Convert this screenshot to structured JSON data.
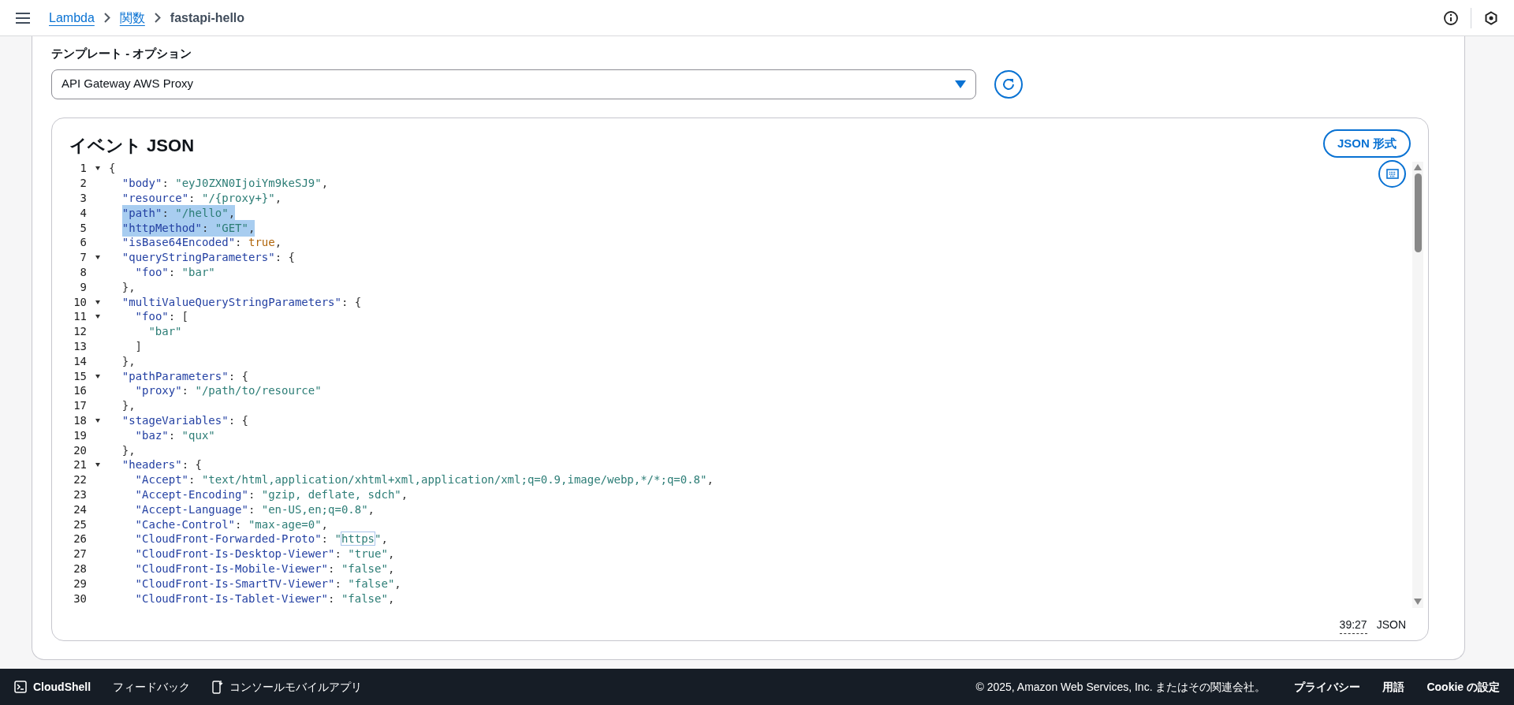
{
  "top_bar": {
    "breadcrumbs": [
      {
        "label": "Lambda",
        "kind": "link"
      },
      {
        "label": "関数",
        "kind": "link"
      },
      {
        "label": "fastapi-hello",
        "kind": "current"
      }
    ]
  },
  "template": {
    "label": "テンプレート - オプション",
    "value": "API Gateway AWS Proxy"
  },
  "editor": {
    "title": "イベント JSON",
    "format_button": "JSON 形式",
    "lines": [
      {
        "number": "1",
        "foldable": true,
        "selected": false,
        "tokens": [
          {
            "kind": "punct",
            "text": "{"
          }
        ],
        "children": [
          {
            "number": "2",
            "foldable": false,
            "selected": false,
            "tokens": [
              {
                "kind": "key",
                "text": "\"body\""
              },
              {
                "kind": "punct",
                "text": ": "
              },
              {
                "kind": "string",
                "text": "\"eyJ0ZXN0IjoiYm9keSJ9\""
              },
              {
                "kind": "punct",
                "text": ","
              }
            ]
          },
          {
            "number": "3",
            "foldable": false,
            "selected": false,
            "tokens": [
              {
                "kind": "key",
                "text": "\"resource\""
              },
              {
                "kind": "punct",
                "text": ": "
              },
              {
                "kind": "string",
                "text": "\"/{proxy+}\""
              },
              {
                "kind": "punct",
                "text": ","
              }
            ]
          },
          {
            "number": "4",
            "foldable": false,
            "selected": true,
            "tokens": [
              {
                "kind": "key",
                "text": "\"path\""
              },
              {
                "kind": "punct",
                "text": ": "
              },
              {
                "kind": "string",
                "text": "\"/hello\""
              },
              {
                "kind": "punct",
                "text": ","
              }
            ]
          },
          {
            "number": "5",
            "foldable": false,
            "selected": true,
            "tokens": [
              {
                "kind": "key",
                "text": "\"httpMethod\""
              },
              {
                "kind": "punct",
                "text": ": "
              },
              {
                "kind": "string",
                "text": "\"GET\""
              },
              {
                "kind": "punct",
                "text": ","
              }
            ]
          },
          {
            "number": "6",
            "foldable": false,
            "selected": false,
            "tokens": [
              {
                "kind": "key",
                "text": "\"isBase64Encoded\""
              },
              {
                "kind": "punct",
                "text": ": "
              },
              {
                "kind": "bool",
                "text": "true"
              },
              {
                "kind": "punct",
                "text": ","
              }
            ]
          },
          {
            "number": "7",
            "foldable": true,
            "selected": false,
            "tokens": [
              {
                "kind": "key",
                "text": "\"queryStringParameters\""
              },
              {
                "kind": "punct",
                "text": ": {"
              }
            ],
            "children": [
              {
                "number": "8",
                "foldable": false,
                "selected": false,
                "tokens": [
                  {
                    "kind": "key",
                    "text": "\"foo\""
                  },
                  {
                    "kind": "punct",
                    "text": ": "
                  },
                  {
                    "kind": "string",
                    "text": "\"bar\""
                  }
                ]
              }
            ]
          },
          {
            "number": "9",
            "foldable": false,
            "selected": false,
            "tokens": [
              {
                "kind": "punct",
                "text": "},"
              }
            ]
          },
          {
            "number": "10",
            "foldable": true,
            "selected": false,
            "tokens": [
              {
                "kind": "key",
                "text": "\"multiValueQueryStringParameters\""
              },
              {
                "kind": "punct",
                "text": ": {"
              }
            ],
            "children": [
              {
                "number": "11",
                "foldable": true,
                "selected": false,
                "tokens": [
                  {
                    "kind": "key",
                    "text": "\"foo\""
                  },
                  {
                    "kind": "punct",
                    "text": ": ["
                  }
                ],
                "children": [
                  {
                    "number": "12",
                    "foldable": false,
                    "selected": false,
                    "tokens": [
                      {
                        "kind": "string",
                        "text": "\"bar\""
                      }
                    ]
                  }
                ]
              },
              {
                "number": "13",
                "foldable": false,
                "selected": false,
                "tokens": [
                  {
                    "kind": "punct",
                    "text": "]"
                  }
                ]
              }
            ]
          },
          {
            "number": "14",
            "foldable": false,
            "selected": false,
            "tokens": [
              {
                "kind": "punct",
                "text": "},"
              }
            ]
          },
          {
            "number": "15",
            "foldable": true,
            "selected": false,
            "tokens": [
              {
                "kind": "key",
                "text": "\"pathParameters\""
              },
              {
                "kind": "punct",
                "text": ": {"
              }
            ],
            "children": [
              {
                "number": "16",
                "foldable": false,
                "selected": false,
                "tokens": [
                  {
                    "kind": "key",
                    "text": "\"proxy\""
                  },
                  {
                    "kind": "punct",
                    "text": ": "
                  },
                  {
                    "kind": "string",
                    "text": "\"/path/to/resource\""
                  }
                ]
              }
            ]
          },
          {
            "number": "17",
            "foldable": false,
            "selected": false,
            "tokens": [
              {
                "kind": "punct",
                "text": "},"
              }
            ]
          },
          {
            "number": "18",
            "foldable": true,
            "selected": false,
            "tokens": [
              {
                "kind": "key",
                "text": "\"stageVariables\""
              },
              {
                "kind": "punct",
                "text": ": {"
              }
            ],
            "children": [
              {
                "number": "19",
                "foldable": false,
                "selected": false,
                "tokens": [
                  {
                    "kind": "key",
                    "text": "\"baz\""
                  },
                  {
                    "kind": "punct",
                    "text": ": "
                  },
                  {
                    "kind": "string",
                    "text": "\"qux\""
                  }
                ]
              }
            ]
          },
          {
            "number": "20",
            "foldable": false,
            "selected": false,
            "tokens": [
              {
                "kind": "punct",
                "text": "},"
              }
            ]
          },
          {
            "number": "21",
            "foldable": true,
            "selected": false,
            "tokens": [
              {
                "kind": "key",
                "text": "\"headers\""
              },
              {
                "kind": "punct",
                "text": ": {"
              }
            ],
            "children": [
              {
                "number": "22",
                "foldable": false,
                "selected": false,
                "tokens": [
                  {
                    "kind": "key",
                    "text": "\"Accept\""
                  },
                  {
                    "kind": "punct",
                    "text": ": "
                  },
                  {
                    "kind": "string",
                    "text": "\"text/html,application/xhtml+xml,application/xml;q=0.9,image/webp,*/*;q=0.8\""
                  },
                  {
                    "kind": "punct",
                    "text": ","
                  }
                ]
              },
              {
                "number": "23",
                "foldable": false,
                "selected": false,
                "tokens": [
                  {
                    "kind": "key",
                    "text": "\"Accept-Encoding\""
                  },
                  {
                    "kind": "punct",
                    "text": ": "
                  },
                  {
                    "kind": "string",
                    "text": "\"gzip, deflate, sdch\""
                  },
                  {
                    "kind": "punct",
                    "text": ","
                  }
                ]
              },
              {
                "number": "24",
                "foldable": false,
                "selected": false,
                "tokens": [
                  {
                    "kind": "key",
                    "text": "\"Accept-Language\""
                  },
                  {
                    "kind": "punct",
                    "text": ": "
                  },
                  {
                    "kind": "string",
                    "text": "\"en-US,en;q=0.8\""
                  },
                  {
                    "kind": "punct",
                    "text": ","
                  }
                ]
              },
              {
                "number": "25",
                "foldable": false,
                "selected": false,
                "tokens": [
                  {
                    "kind": "key",
                    "text": "\"Cache-Control\""
                  },
                  {
                    "kind": "punct",
                    "text": ": "
                  },
                  {
                    "kind": "string",
                    "text": "\"max-age=0\""
                  },
                  {
                    "kind": "punct",
                    "text": ","
                  }
                ]
              },
              {
                "number": "26",
                "foldable": false,
                "selected": false,
                "tokens": [
                  {
                    "kind": "key",
                    "text": "\"CloudFront-Forwarded-Proto\""
                  },
                  {
                    "kind": "punct",
                    "text": ": "
                  },
                  {
                    "kind": "string",
                    "text": "\""
                  },
                  {
                    "kind": "match",
                    "text": "https"
                  },
                  {
                    "kind": "string",
                    "text": "\""
                  },
                  {
                    "kind": "punct",
                    "text": ","
                  }
                ]
              },
              {
                "number": "27",
                "foldable": false,
                "selected": false,
                "tokens": [
                  {
                    "kind": "key",
                    "text": "\"CloudFront-Is-Desktop-Viewer\""
                  },
                  {
                    "kind": "punct",
                    "text": ": "
                  },
                  {
                    "kind": "string",
                    "text": "\"true\""
                  },
                  {
                    "kind": "punct",
                    "text": ","
                  }
                ]
              },
              {
                "number": "28",
                "foldable": false,
                "selected": false,
                "tokens": [
                  {
                    "kind": "key",
                    "text": "\"CloudFront-Is-Mobile-Viewer\""
                  },
                  {
                    "kind": "punct",
                    "text": ": "
                  },
                  {
                    "kind": "string",
                    "text": "\"false\""
                  },
                  {
                    "kind": "punct",
                    "text": ","
                  }
                ]
              },
              {
                "number": "29",
                "foldable": false,
                "selected": false,
                "tokens": [
                  {
                    "kind": "key",
                    "text": "\"CloudFront-Is-SmartTV-Viewer\""
                  },
                  {
                    "kind": "punct",
                    "text": ": "
                  },
                  {
                    "kind": "string",
                    "text": "\"false\""
                  },
                  {
                    "kind": "punct",
                    "text": ","
                  }
                ]
              },
              {
                "number": "30",
                "foldable": false,
                "selected": false,
                "tokens": [
                  {
                    "kind": "key",
                    "text": "\"CloudFront-Is-Tablet-Viewer\""
                  },
                  {
                    "kind": "punct",
                    "text": ": "
                  },
                  {
                    "kind": "string",
                    "text": "\"false\""
                  },
                  {
                    "kind": "punct",
                    "text": ","
                  }
                ]
              }
            ]
          }
        ]
      }
    ],
    "status": {
      "cursor": "39:27",
      "mode": "JSON"
    }
  },
  "footer": {
    "left": [
      {
        "label": "CloudShell",
        "kind": "cloudshell"
      },
      {
        "label": "フィードバック",
        "kind": "plain"
      },
      {
        "label": "コンソールモバイルアプリ",
        "kind": "mobile"
      }
    ],
    "copyright": "© 2025, Amazon Web Services, Inc. またはその関連会社。",
    "right": [
      "プライバシー",
      "用語",
      "Cookie の設定"
    ]
  }
}
